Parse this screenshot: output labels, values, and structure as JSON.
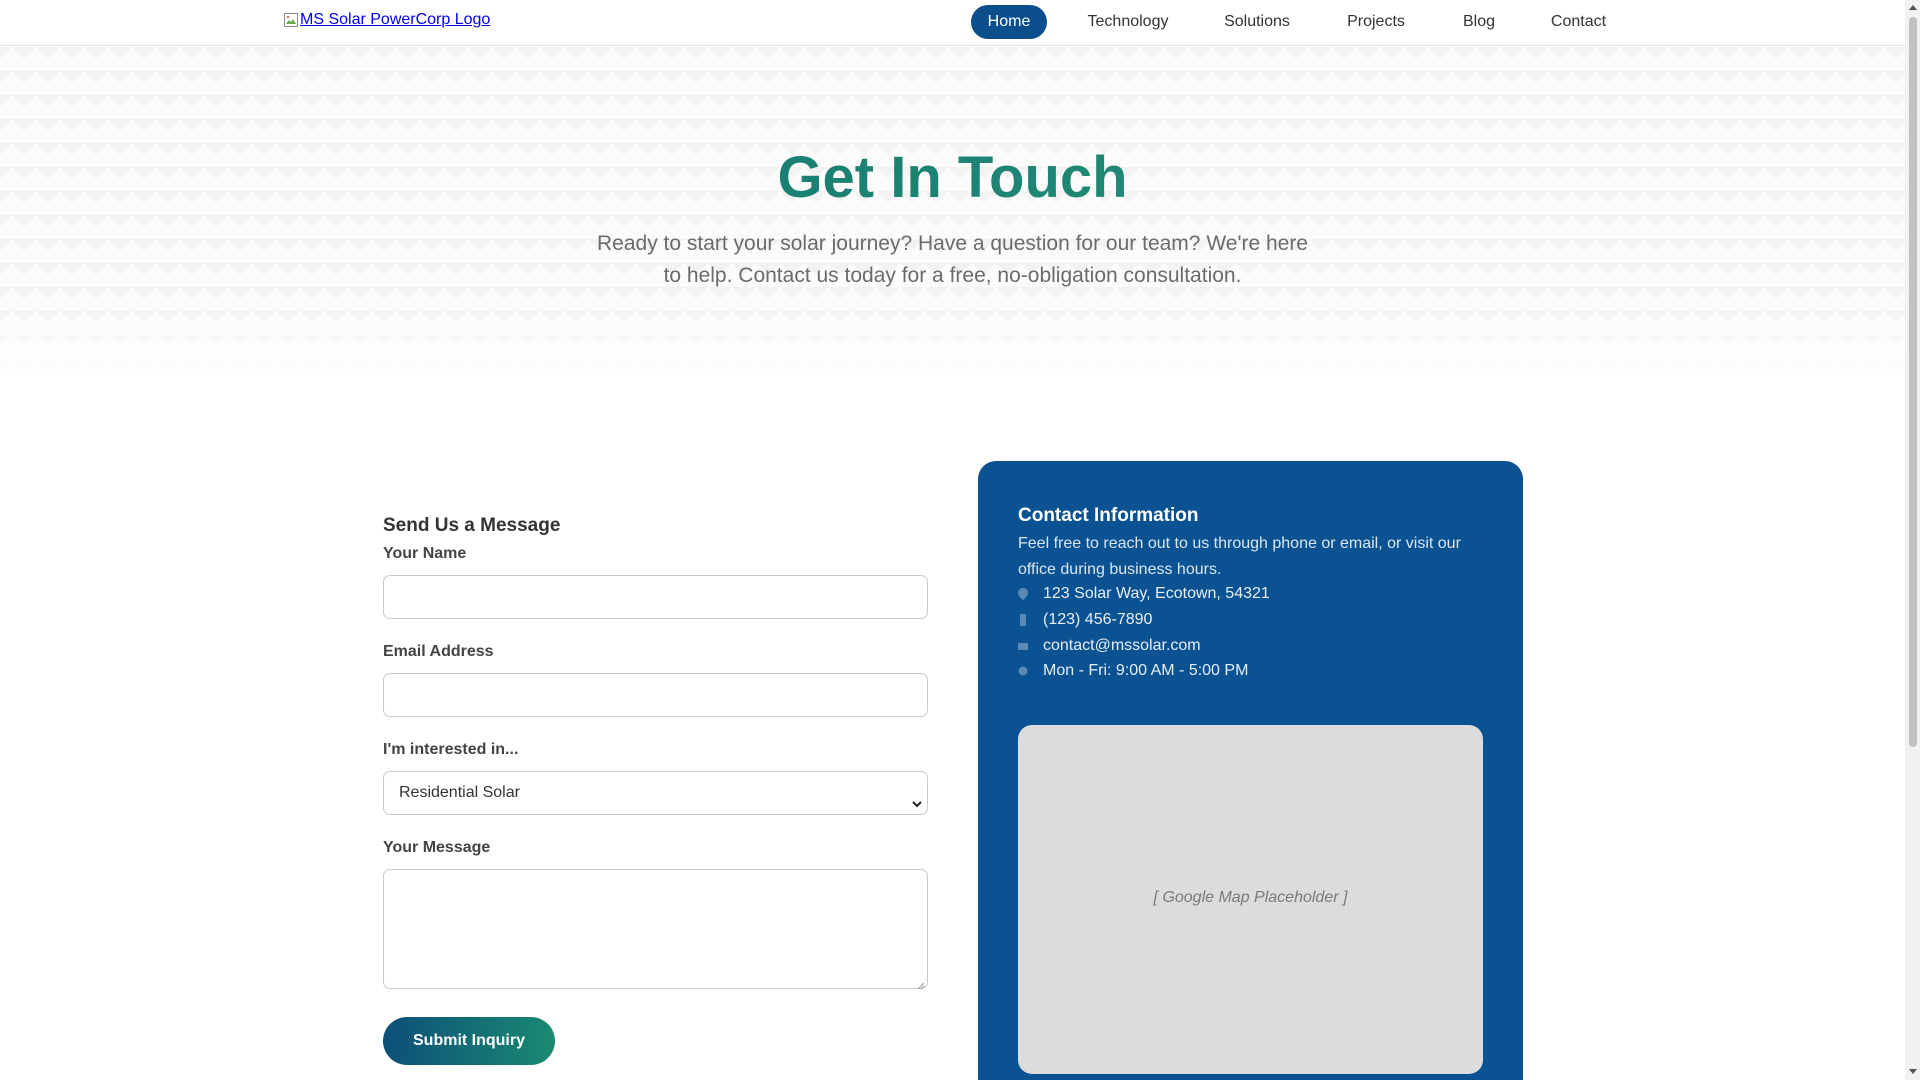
{
  "header": {
    "logo_alt": "MS Solar PowerCorp Logo",
    "nav": [
      {
        "label": "Home",
        "active": true
      },
      {
        "label": "Technology",
        "active": false
      },
      {
        "label": "Solutions",
        "active": false
      },
      {
        "label": "Projects",
        "active": false
      },
      {
        "label": "Blog",
        "active": false
      },
      {
        "label": "Contact",
        "active": false
      }
    ]
  },
  "hero": {
    "title": "Get In Touch",
    "subtitle": "Ready to start your solar journey? Have a question for our team? We're here to help. Contact us today for a free, no-obligation consultation."
  },
  "form": {
    "title": "Send Us a Message",
    "name_label": "Your Name",
    "name_value": "",
    "email_label": "Email Address",
    "email_value": "",
    "interest_label": "I'm interested in...",
    "interest_selected": "Residential Solar",
    "message_label": "Your Message",
    "message_value": "",
    "submit_label": "Submit Inquiry"
  },
  "contact": {
    "title": "Contact Information",
    "description": "Feel free to reach out to us through phone or email, or visit our office during business hours.",
    "address": "123 Solar Way, Ecotown, 54321",
    "phone": "(123) 456-7890",
    "email": "contact@mssolar.com",
    "hours": "Mon - Fri: 9:00 AM - 5:00 PM",
    "map_placeholder": "[ Google Map Placeholder ]"
  },
  "colors": {
    "nav_active_bg": "#0a4f8c",
    "hero_title": "#1f8a73",
    "panel_bg": "#0a5292",
    "button_gradient_start": "#0d4f78",
    "button_gradient_end": "#1a8a72"
  },
  "icons": {
    "logo": "broken-image-icon",
    "address": "map-marker-icon",
    "phone": "phone-icon",
    "email": "envelope-icon",
    "hours": "clock-icon"
  }
}
